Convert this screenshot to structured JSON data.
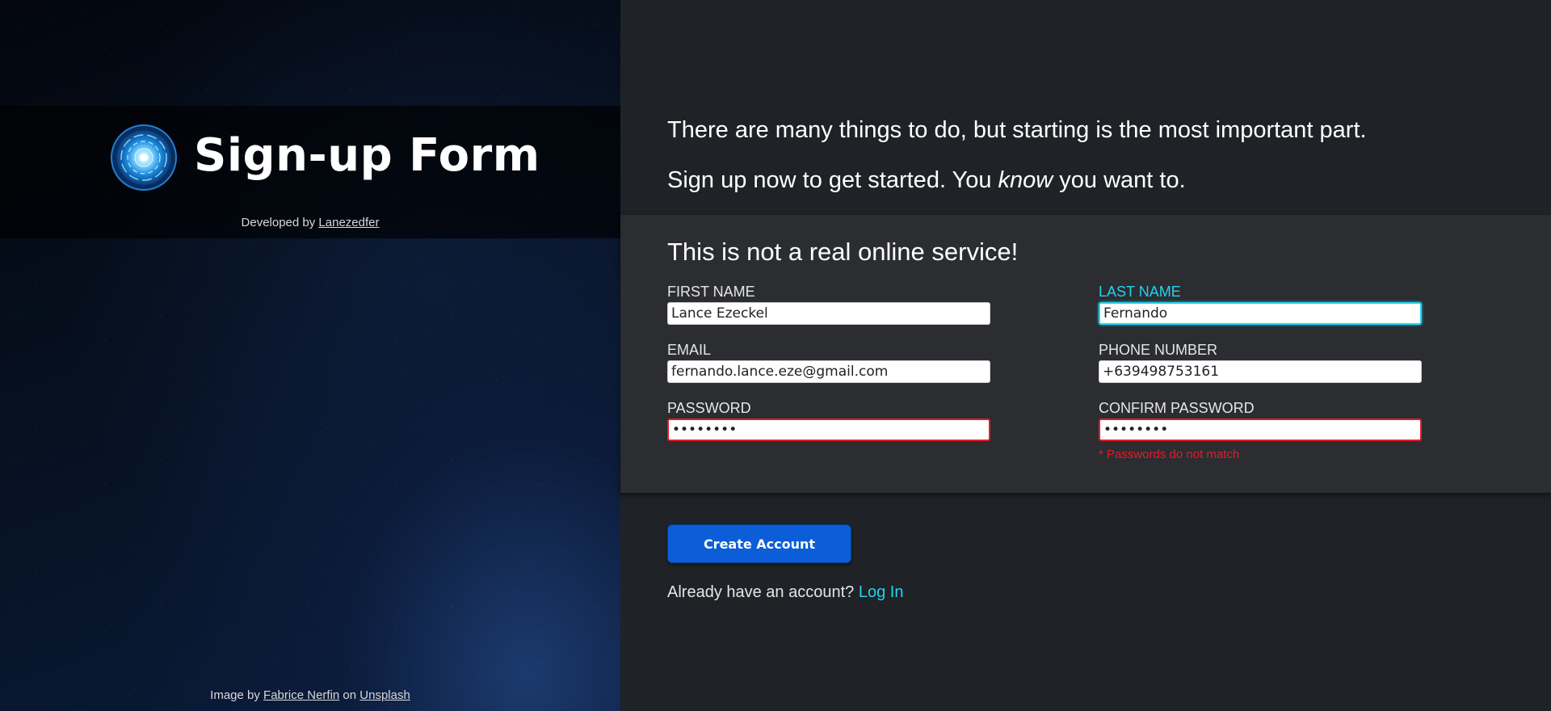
{
  "brand": {
    "title": "Sign-up Form",
    "developed_prefix": "Developed by",
    "developer": "Lanezedfer",
    "logo_icon": "glowing-orb-logo"
  },
  "credit": {
    "prefix": "Image by",
    "author": "Fabrice Nerfin",
    "middle": "on",
    "source": "Unsplash"
  },
  "intro": {
    "line1": "There are many things to do, but starting is the most important part.",
    "line2_before": "Sign up now to get started. You",
    "line2_em": "know",
    "line2_after": "you want to."
  },
  "form": {
    "heading": "This is not a real online service!",
    "first_name": {
      "label": "FIRST NAME",
      "value": "Lance Ezeckel"
    },
    "last_name": {
      "label": "LAST NAME",
      "value": "Fernando"
    },
    "email": {
      "label": "EMAIL",
      "value": "fernando.lance.eze@gmail.com"
    },
    "phone": {
      "label": "PHONE NUMBER",
      "value": "+639498753161"
    },
    "password": {
      "label": "PASSWORD",
      "value": "••••••••"
    },
    "confirm_password": {
      "label": "CONFIRM PASSWORD",
      "value": "••••••••"
    },
    "error": "* Passwords do not match"
  },
  "actions": {
    "create_label": "Create Account",
    "login_prompt": "Already have an account?",
    "login_link": "Log In"
  },
  "colors": {
    "accent": "#22d3ee",
    "button": "#0b5ed7",
    "error": "#e11d2a",
    "panel": "#2b2d31",
    "background": "#1f2226"
  }
}
